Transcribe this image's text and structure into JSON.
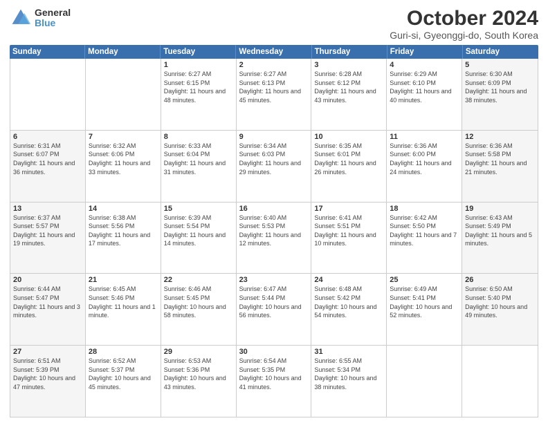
{
  "logo": {
    "general": "General",
    "blue": "Blue"
  },
  "title": "October 2024",
  "subtitle": "Guri-si, Gyeonggi-do, South Korea",
  "weekdays": [
    "Sunday",
    "Monday",
    "Tuesday",
    "Wednesday",
    "Thursday",
    "Friday",
    "Saturday"
  ],
  "weeks": [
    [
      {
        "day": "",
        "sunrise": "",
        "sunset": "",
        "daylight": ""
      },
      {
        "day": "",
        "sunrise": "",
        "sunset": "",
        "daylight": ""
      },
      {
        "day": "1",
        "sunrise": "Sunrise: 6:27 AM",
        "sunset": "Sunset: 6:15 PM",
        "daylight": "Daylight: 11 hours and 48 minutes."
      },
      {
        "day": "2",
        "sunrise": "Sunrise: 6:27 AM",
        "sunset": "Sunset: 6:13 PM",
        "daylight": "Daylight: 11 hours and 45 minutes."
      },
      {
        "day": "3",
        "sunrise": "Sunrise: 6:28 AM",
        "sunset": "Sunset: 6:12 PM",
        "daylight": "Daylight: 11 hours and 43 minutes."
      },
      {
        "day": "4",
        "sunrise": "Sunrise: 6:29 AM",
        "sunset": "Sunset: 6:10 PM",
        "daylight": "Daylight: 11 hours and 40 minutes."
      },
      {
        "day": "5",
        "sunrise": "Sunrise: 6:30 AM",
        "sunset": "Sunset: 6:09 PM",
        "daylight": "Daylight: 11 hours and 38 minutes."
      }
    ],
    [
      {
        "day": "6",
        "sunrise": "Sunrise: 6:31 AM",
        "sunset": "Sunset: 6:07 PM",
        "daylight": "Daylight: 11 hours and 36 minutes."
      },
      {
        "day": "7",
        "sunrise": "Sunrise: 6:32 AM",
        "sunset": "Sunset: 6:06 PM",
        "daylight": "Daylight: 11 hours and 33 minutes."
      },
      {
        "day": "8",
        "sunrise": "Sunrise: 6:33 AM",
        "sunset": "Sunset: 6:04 PM",
        "daylight": "Daylight: 11 hours and 31 minutes."
      },
      {
        "day": "9",
        "sunrise": "Sunrise: 6:34 AM",
        "sunset": "Sunset: 6:03 PM",
        "daylight": "Daylight: 11 hours and 29 minutes."
      },
      {
        "day": "10",
        "sunrise": "Sunrise: 6:35 AM",
        "sunset": "Sunset: 6:01 PM",
        "daylight": "Daylight: 11 hours and 26 minutes."
      },
      {
        "day": "11",
        "sunrise": "Sunrise: 6:36 AM",
        "sunset": "Sunset: 6:00 PM",
        "daylight": "Daylight: 11 hours and 24 minutes."
      },
      {
        "day": "12",
        "sunrise": "Sunrise: 6:36 AM",
        "sunset": "Sunset: 5:58 PM",
        "daylight": "Daylight: 11 hours and 21 minutes."
      }
    ],
    [
      {
        "day": "13",
        "sunrise": "Sunrise: 6:37 AM",
        "sunset": "Sunset: 5:57 PM",
        "daylight": "Daylight: 11 hours and 19 minutes."
      },
      {
        "day": "14",
        "sunrise": "Sunrise: 6:38 AM",
        "sunset": "Sunset: 5:56 PM",
        "daylight": "Daylight: 11 hours and 17 minutes."
      },
      {
        "day": "15",
        "sunrise": "Sunrise: 6:39 AM",
        "sunset": "Sunset: 5:54 PM",
        "daylight": "Daylight: 11 hours and 14 minutes."
      },
      {
        "day": "16",
        "sunrise": "Sunrise: 6:40 AM",
        "sunset": "Sunset: 5:53 PM",
        "daylight": "Daylight: 11 hours and 12 minutes."
      },
      {
        "day": "17",
        "sunrise": "Sunrise: 6:41 AM",
        "sunset": "Sunset: 5:51 PM",
        "daylight": "Daylight: 11 hours and 10 minutes."
      },
      {
        "day": "18",
        "sunrise": "Sunrise: 6:42 AM",
        "sunset": "Sunset: 5:50 PM",
        "daylight": "Daylight: 11 hours and 7 minutes."
      },
      {
        "day": "19",
        "sunrise": "Sunrise: 6:43 AM",
        "sunset": "Sunset: 5:49 PM",
        "daylight": "Daylight: 11 hours and 5 minutes."
      }
    ],
    [
      {
        "day": "20",
        "sunrise": "Sunrise: 6:44 AM",
        "sunset": "Sunset: 5:47 PM",
        "daylight": "Daylight: 11 hours and 3 minutes."
      },
      {
        "day": "21",
        "sunrise": "Sunrise: 6:45 AM",
        "sunset": "Sunset: 5:46 PM",
        "daylight": "Daylight: 11 hours and 1 minute."
      },
      {
        "day": "22",
        "sunrise": "Sunrise: 6:46 AM",
        "sunset": "Sunset: 5:45 PM",
        "daylight": "Daylight: 10 hours and 58 minutes."
      },
      {
        "day": "23",
        "sunrise": "Sunrise: 6:47 AM",
        "sunset": "Sunset: 5:44 PM",
        "daylight": "Daylight: 10 hours and 56 minutes."
      },
      {
        "day": "24",
        "sunrise": "Sunrise: 6:48 AM",
        "sunset": "Sunset: 5:42 PM",
        "daylight": "Daylight: 10 hours and 54 minutes."
      },
      {
        "day": "25",
        "sunrise": "Sunrise: 6:49 AM",
        "sunset": "Sunset: 5:41 PM",
        "daylight": "Daylight: 10 hours and 52 minutes."
      },
      {
        "day": "26",
        "sunrise": "Sunrise: 6:50 AM",
        "sunset": "Sunset: 5:40 PM",
        "daylight": "Daylight: 10 hours and 49 minutes."
      }
    ],
    [
      {
        "day": "27",
        "sunrise": "Sunrise: 6:51 AM",
        "sunset": "Sunset: 5:39 PM",
        "daylight": "Daylight: 10 hours and 47 minutes."
      },
      {
        "day": "28",
        "sunrise": "Sunrise: 6:52 AM",
        "sunset": "Sunset: 5:37 PM",
        "daylight": "Daylight: 10 hours and 45 minutes."
      },
      {
        "day": "29",
        "sunrise": "Sunrise: 6:53 AM",
        "sunset": "Sunset: 5:36 PM",
        "daylight": "Daylight: 10 hours and 43 minutes."
      },
      {
        "day": "30",
        "sunrise": "Sunrise: 6:54 AM",
        "sunset": "Sunset: 5:35 PM",
        "daylight": "Daylight: 10 hours and 41 minutes."
      },
      {
        "day": "31",
        "sunrise": "Sunrise: 6:55 AM",
        "sunset": "Sunset: 5:34 PM",
        "daylight": "Daylight: 10 hours and 38 minutes."
      },
      {
        "day": "",
        "sunrise": "",
        "sunset": "",
        "daylight": ""
      },
      {
        "day": "",
        "sunrise": "",
        "sunset": "",
        "daylight": ""
      }
    ]
  ]
}
